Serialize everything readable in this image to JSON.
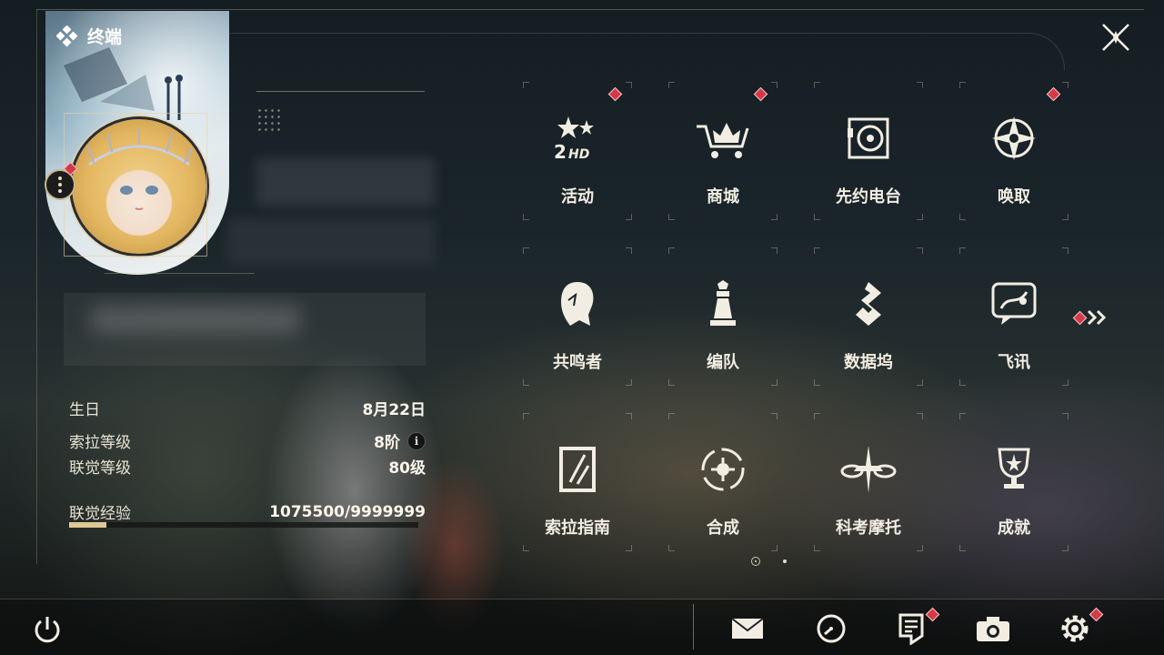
{
  "header": {
    "title": "终端"
  },
  "profile": {
    "birthday_label": "生日",
    "birthday_value": "8月22日",
    "sola_level_label": "索拉等级",
    "sola_level_value": "8阶",
    "union_level_label": "联觉等级",
    "union_level_value": "80级",
    "union_exp_label": "联觉经验",
    "union_exp_value": "1075500/9999999",
    "union_exp_progress": 0.1076,
    "info_icon_glyph": "i"
  },
  "menu": {
    "items": [
      {
        "label": "活动",
        "icon": "event-icon",
        "badge": true
      },
      {
        "label": "商城",
        "icon": "shop-icon",
        "badge": true
      },
      {
        "label": "先约电台",
        "icon": "radio-icon",
        "badge": false
      },
      {
        "label": "唤取",
        "icon": "convene-icon",
        "badge": true
      },
      {
        "label": "共鸣者",
        "icon": "resonator-icon",
        "badge": false
      },
      {
        "label": "编队",
        "icon": "team-icon",
        "badge": false
      },
      {
        "label": "数据坞",
        "icon": "data-bank-icon",
        "badge": false
      },
      {
        "label": "飞讯",
        "icon": "message-icon",
        "badge": false
      },
      {
        "label": "索拉指南",
        "icon": "guidebook-icon",
        "badge": false
      },
      {
        "label": "合成",
        "icon": "synthesis-icon",
        "badge": false
      },
      {
        "label": "科考摩托",
        "icon": "motorbike-icon",
        "badge": false
      },
      {
        "label": "成就",
        "icon": "achievement-icon",
        "badge": false
      }
    ],
    "page_count": 2,
    "current_page": 1
  },
  "bottom_bar": {
    "icons": [
      "power-icon",
      "mail-icon",
      "clock-icon",
      "notice-icon",
      "camera-icon",
      "settings-icon"
    ]
  },
  "colors": {
    "accent": "#e0c995",
    "badge": "#d33a47",
    "text": "#f2ede2"
  }
}
